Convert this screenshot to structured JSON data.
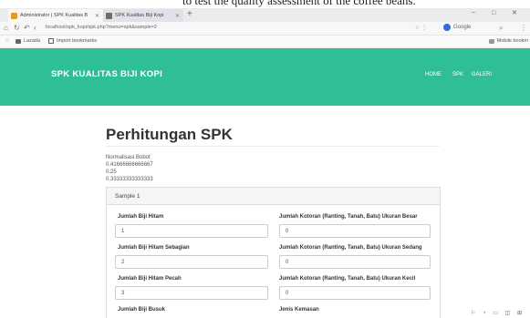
{
  "caption": "to test the quality assessment of the coffee beans.",
  "browser": {
    "tabs": [
      {
        "label": "Administrator | SPK Kualitas B"
      },
      {
        "label": "SPK Kualitas Biji Kopi"
      }
    ],
    "new_tab": "+",
    "window_controls": "− □ ✕",
    "url": "localhost/spk_kopi/spk.php?menu=spk&sample=2",
    "search_engine": "Google",
    "bookmarks": [
      {
        "label": "Lazada"
      },
      {
        "label": "Import bookmarks"
      }
    ],
    "mobile_bookmarks": "Mobile bookm"
  },
  "app": {
    "brand": "SPK KUALITAS BIJI KOPI",
    "nav": [
      "HOME",
      "SPK",
      "GALERI"
    ]
  },
  "content": {
    "title": "Perhitungan SPK",
    "normalisasi_label": "Normalisasi Bobot",
    "weights": [
      "0.41666666666667",
      "0.25",
      "0.33333333333333"
    ],
    "panel_title": "Sample 1",
    "left_fields": [
      {
        "label": "Jumlah Biji Hitam",
        "value": "1"
      },
      {
        "label": "Jumlah Biji Hitam Sebagian",
        "value": "2"
      },
      {
        "label": "Jumlah Biji Hitam Pecah",
        "value": "3"
      },
      {
        "label": "Jumlah Biji Busuk",
        "value": ""
      }
    ],
    "right_fields": [
      {
        "label": "Jumlah Kotoran (Ranting, Tanah, Batu) Ukuran Besar",
        "value": "0"
      },
      {
        "label": "Jumlah Kotoran (Ranting, Tanah, Batu) Ukuran Sedang",
        "value": "0"
      },
      {
        "label": "Jumlah Kotoran (Ranting, Tanah, Batu) Ukuran Kecil",
        "value": "0"
      },
      {
        "label": "Jenis Kemasan",
        "value": ""
      }
    ]
  },
  "colors": {
    "header_bg": "#2fbf97",
    "brand_text": "#ffffff"
  }
}
